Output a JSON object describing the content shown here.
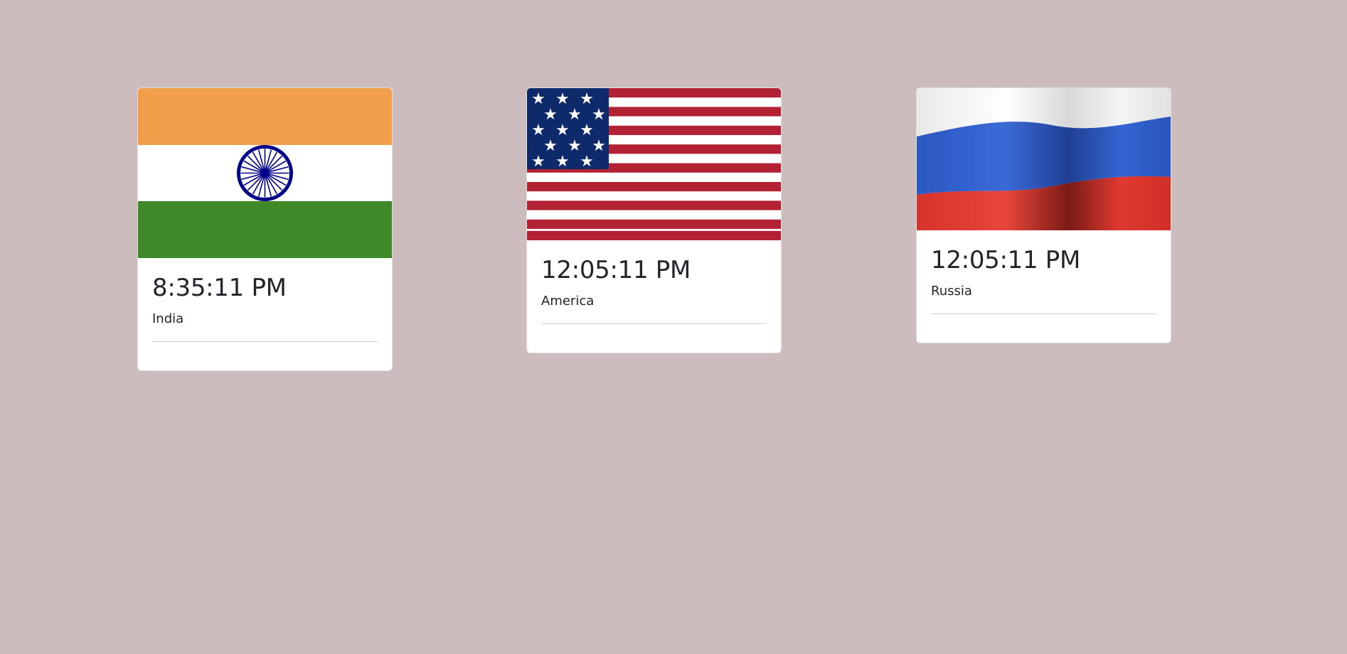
{
  "cards": [
    {
      "time": "8:35:11 PM",
      "country": "India",
      "flag_icon": "india-flag",
      "flag_colors": [
        "#f19e4d",
        "#ffffff",
        "#408928",
        "#000088"
      ]
    },
    {
      "time": "12:05:11 PM",
      "country": "America",
      "flag_icon": "usa-flag",
      "flag_colors": [
        "#b22234",
        "#ffffff",
        "#0f2a6b"
      ]
    },
    {
      "time": "12:05:11 PM",
      "country": "Russia",
      "flag_icon": "russia-flag",
      "flag_colors": [
        "#f5f5f5",
        "#2f5ec8",
        "#d9342b"
      ]
    }
  ],
  "page_background": "#cdbcbd"
}
